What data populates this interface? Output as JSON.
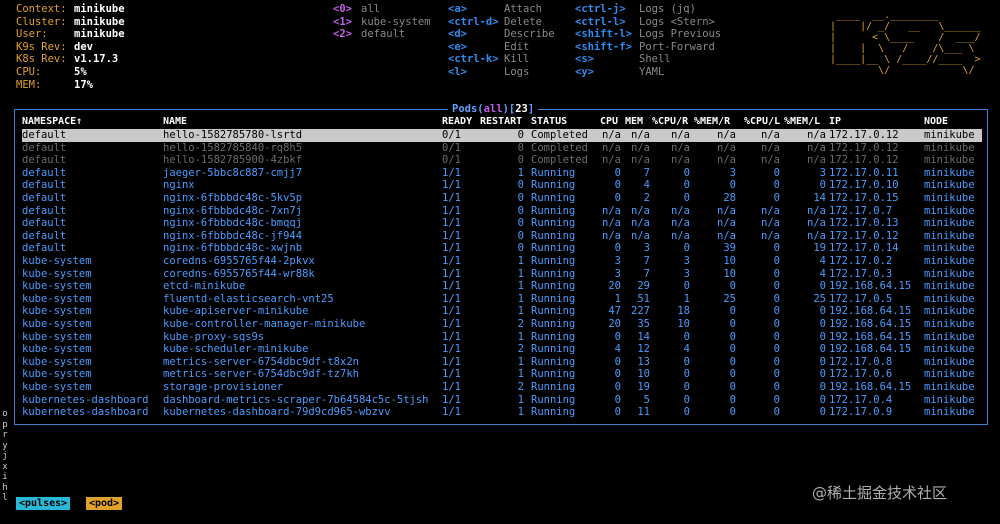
{
  "info": [
    {
      "key": "Context:",
      "value": "minikube"
    },
    {
      "key": "Cluster:",
      "value": "minikube"
    },
    {
      "key": "User:",
      "value": "minikube"
    },
    {
      "key": "K9s Rev:",
      "value": "dev"
    },
    {
      "key": "K8s Rev:",
      "value": "v1.17.3"
    },
    {
      "key": "CPU:",
      "value": "5%"
    },
    {
      "key": "MEM:",
      "value": "17%"
    }
  ],
  "hotkeys": {
    "namespaces": [
      {
        "key": "<0>",
        "label": "all"
      },
      {
        "key": "<1>",
        "label": "kube-system"
      },
      {
        "key": "<2>",
        "label": "default"
      }
    ],
    "actions1": [
      {
        "key": "<a>",
        "label": "Attach"
      },
      {
        "key": "<ctrl-d>",
        "label": "Delete"
      },
      {
        "key": "<d>",
        "label": "Describe"
      },
      {
        "key": "<e>",
        "label": "Edit"
      },
      {
        "key": "<ctrl-k>",
        "label": "Kill"
      },
      {
        "key": "<l>",
        "label": "Logs"
      }
    ],
    "actions2": [
      {
        "key": "<ctrl-j>",
        "label": "Logs (jq)"
      },
      {
        "key": "<ctrl-l>",
        "label": "Logs <Stern>"
      },
      {
        "key": "<shift-l>",
        "label": "Logs Previous"
      },
      {
        "key": "<shift-f>",
        "label": "Port-Forward"
      },
      {
        "key": "<s>",
        "label": "Shell"
      },
      {
        "key": "<y>",
        "label": "YAML"
      }
    ]
  },
  "logo_art": [
    " ____  __.________       ",
    "|    |/ _/   __   \\______",
    "|      < \\____    /  ___/",
    "|    |  \\   /    /\\___ \\ ",
    "|____|__ \\ /____//____  >",
    "        \\/            \\/ "
  ],
  "table": {
    "resource": "Pods",
    "filter": "all",
    "count": "23",
    "title_open": "Pods(",
    "title_mid": ")[",
    "title_close": "]",
    "columns": [
      "NAMESPACE↑",
      "NAME",
      "READY",
      "RESTART",
      "STATUS",
      "CPU",
      "MEM",
      "%CPU/R",
      "%MEM/R",
      "%CPU/L",
      "%MEM/L",
      "IP",
      "NODE"
    ],
    "rows": [
      [
        "default",
        "hello-1582785780-lsrtd",
        "0/1",
        "0",
        "Completed",
        "n/a",
        "n/a",
        "n/a",
        "n/a",
        "n/a",
        "n/a",
        "172.17.0.12",
        "minikube"
      ],
      [
        "default",
        "hello-1582785840-rq8h5",
        "0/1",
        "0",
        "Completed",
        "n/a",
        "n/a",
        "n/a",
        "n/a",
        "n/a",
        "n/a",
        "172.17.0.12",
        "minikube"
      ],
      [
        "default",
        "hello-1582785900-4zbkf",
        "0/1",
        "0",
        "Completed",
        "n/a",
        "n/a",
        "n/a",
        "n/a",
        "n/a",
        "n/a",
        "172.17.0.12",
        "minikube"
      ],
      [
        "default",
        "jaeger-5bbc8c887-cmjj7",
        "1/1",
        "1",
        "Running",
        "0",
        "7",
        "0",
        "3",
        "0",
        "3",
        "172.17.0.11",
        "minikube"
      ],
      [
        "default",
        "nginx",
        "1/1",
        "0",
        "Running",
        "0",
        "4",
        "0",
        "0",
        "0",
        "0",
        "172.17.0.10",
        "minikube"
      ],
      [
        "default",
        "nginx-6fbbbdc48c-5kv5p",
        "1/1",
        "0",
        "Running",
        "0",
        "2",
        "0",
        "28",
        "0",
        "14",
        "172.17.0.15",
        "minikube"
      ],
      [
        "default",
        "nginx-6fbbbdc48c-7xn7j",
        "1/1",
        "0",
        "Running",
        "n/a",
        "n/a",
        "n/a",
        "n/a",
        "n/a",
        "n/a",
        "172.17.0.7",
        "minikube"
      ],
      [
        "default",
        "nginx-6fbbbdc48c-bmqqj",
        "1/1",
        "0",
        "Running",
        "n/a",
        "n/a",
        "n/a",
        "n/a",
        "n/a",
        "n/a",
        "172.17.0.13",
        "minikube"
      ],
      [
        "default",
        "nginx-6fbbbdc48c-jf944",
        "1/1",
        "0",
        "Running",
        "n/a",
        "n/a",
        "n/a",
        "n/a",
        "n/a",
        "n/a",
        "172.17.0.12",
        "minikube"
      ],
      [
        "default",
        "nginx-6fbbbdc48c-xwjnb",
        "1/1",
        "0",
        "Running",
        "0",
        "3",
        "0",
        "39",
        "0",
        "19",
        "172.17.0.14",
        "minikube"
      ],
      [
        "kube-system",
        "coredns-6955765f44-2pkvx",
        "1/1",
        "1",
        "Running",
        "3",
        "7",
        "3",
        "10",
        "0",
        "4",
        "172.17.0.2",
        "minikube"
      ],
      [
        "kube-system",
        "coredns-6955765f44-wr88k",
        "1/1",
        "1",
        "Running",
        "3",
        "7",
        "3",
        "10",
        "0",
        "4",
        "172.17.0.3",
        "minikube"
      ],
      [
        "kube-system",
        "etcd-minikube",
        "1/1",
        "1",
        "Running",
        "20",
        "29",
        "0",
        "0",
        "0",
        "0",
        "192.168.64.15",
        "minikube"
      ],
      [
        "kube-system",
        "fluentd-elasticsearch-vnt25",
        "1/1",
        "1",
        "Running",
        "1",
        "51",
        "1",
        "25",
        "0",
        "25",
        "172.17.0.5",
        "minikube"
      ],
      [
        "kube-system",
        "kube-apiserver-minikube",
        "1/1",
        "1",
        "Running",
        "47",
        "227",
        "18",
        "0",
        "0",
        "0",
        "192.168.64.15",
        "minikube"
      ],
      [
        "kube-system",
        "kube-controller-manager-minikube",
        "1/1",
        "2",
        "Running",
        "20",
        "35",
        "10",
        "0",
        "0",
        "0",
        "192.168.64.15",
        "minikube"
      ],
      [
        "kube-system",
        "kube-proxy-sqs9s",
        "1/1",
        "1",
        "Running",
        "0",
        "14",
        "0",
        "0",
        "0",
        "0",
        "192.168.64.15",
        "minikube"
      ],
      [
        "kube-system",
        "kube-scheduler-minikube",
        "1/1",
        "2",
        "Running",
        "4",
        "12",
        "4",
        "0",
        "0",
        "0",
        "192.168.64.15",
        "minikube"
      ],
      [
        "kube-system",
        "metrics-server-6754dbc9df-t8x2n",
        "1/1",
        "1",
        "Running",
        "0",
        "13",
        "0",
        "0",
        "0",
        "0",
        "172.17.0.8",
        "minikube"
      ],
      [
        "kube-system",
        "metrics-server-6754dbc9df-tz7kh",
        "1/1",
        "1",
        "Running",
        "0",
        "10",
        "0",
        "0",
        "0",
        "0",
        "172.17.0.6",
        "minikube"
      ],
      [
        "kube-system",
        "storage-provisioner",
        "1/1",
        "2",
        "Running",
        "0",
        "19",
        "0",
        "0",
        "0",
        "0",
        "192.168.64.15",
        "minikube"
      ],
      [
        "kubernetes-dashboard",
        "dashboard-metrics-scraper-7b64584c5c-5tjsh",
        "1/1",
        "1",
        "Running",
        "0",
        "5",
        "0",
        "0",
        "0",
        "0",
        "172.17.0.4",
        "minikube"
      ],
      [
        "kubernetes-dashboard",
        "kubernetes-dashboard-79d9cd965-wbzvv",
        "1/1",
        "1",
        "Running",
        "0",
        "11",
        "0",
        "0",
        "0",
        "0",
        "172.17.0.9",
        "minikube"
      ]
    ]
  },
  "sidebar_chars": [
    "o",
    "p",
    "r",
    "y",
    "j",
    "x",
    "i",
    "h",
    "l"
  ],
  "breadcrumbs": [
    "<pulses>",
    "<pod>"
  ],
  "watermark": "@稀土掘金技术社区",
  "colors": {
    "accent_orange": "#e0a22a",
    "key_blue": "#2f8cf0",
    "running_blue": "#4a9cff",
    "frame_blue": "#3f7fd0"
  }
}
